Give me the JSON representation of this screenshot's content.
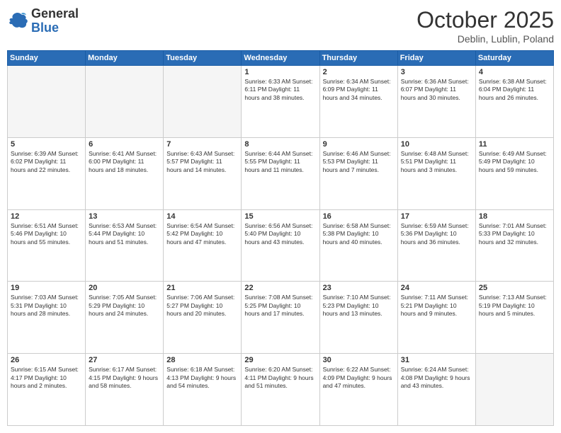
{
  "header": {
    "logo_general": "General",
    "logo_blue": "Blue",
    "month": "October 2025",
    "location": "Deblin, Lublin, Poland"
  },
  "weekdays": [
    "Sunday",
    "Monday",
    "Tuesday",
    "Wednesday",
    "Thursday",
    "Friday",
    "Saturday"
  ],
  "weeks": [
    [
      {
        "day": "",
        "info": ""
      },
      {
        "day": "",
        "info": ""
      },
      {
        "day": "",
        "info": ""
      },
      {
        "day": "1",
        "info": "Sunrise: 6:33 AM\nSunset: 6:11 PM\nDaylight: 11 hours\nand 38 minutes."
      },
      {
        "day": "2",
        "info": "Sunrise: 6:34 AM\nSunset: 6:09 PM\nDaylight: 11 hours\nand 34 minutes."
      },
      {
        "day": "3",
        "info": "Sunrise: 6:36 AM\nSunset: 6:07 PM\nDaylight: 11 hours\nand 30 minutes."
      },
      {
        "day": "4",
        "info": "Sunrise: 6:38 AM\nSunset: 6:04 PM\nDaylight: 11 hours\nand 26 minutes."
      }
    ],
    [
      {
        "day": "5",
        "info": "Sunrise: 6:39 AM\nSunset: 6:02 PM\nDaylight: 11 hours\nand 22 minutes."
      },
      {
        "day": "6",
        "info": "Sunrise: 6:41 AM\nSunset: 6:00 PM\nDaylight: 11 hours\nand 18 minutes."
      },
      {
        "day": "7",
        "info": "Sunrise: 6:43 AM\nSunset: 5:57 PM\nDaylight: 11 hours\nand 14 minutes."
      },
      {
        "day": "8",
        "info": "Sunrise: 6:44 AM\nSunset: 5:55 PM\nDaylight: 11 hours\nand 11 minutes."
      },
      {
        "day": "9",
        "info": "Sunrise: 6:46 AM\nSunset: 5:53 PM\nDaylight: 11 hours\nand 7 minutes."
      },
      {
        "day": "10",
        "info": "Sunrise: 6:48 AM\nSunset: 5:51 PM\nDaylight: 11 hours\nand 3 minutes."
      },
      {
        "day": "11",
        "info": "Sunrise: 6:49 AM\nSunset: 5:49 PM\nDaylight: 10 hours\nand 59 minutes."
      }
    ],
    [
      {
        "day": "12",
        "info": "Sunrise: 6:51 AM\nSunset: 5:46 PM\nDaylight: 10 hours\nand 55 minutes."
      },
      {
        "day": "13",
        "info": "Sunrise: 6:53 AM\nSunset: 5:44 PM\nDaylight: 10 hours\nand 51 minutes."
      },
      {
        "day": "14",
        "info": "Sunrise: 6:54 AM\nSunset: 5:42 PM\nDaylight: 10 hours\nand 47 minutes."
      },
      {
        "day": "15",
        "info": "Sunrise: 6:56 AM\nSunset: 5:40 PM\nDaylight: 10 hours\nand 43 minutes."
      },
      {
        "day": "16",
        "info": "Sunrise: 6:58 AM\nSunset: 5:38 PM\nDaylight: 10 hours\nand 40 minutes."
      },
      {
        "day": "17",
        "info": "Sunrise: 6:59 AM\nSunset: 5:36 PM\nDaylight: 10 hours\nand 36 minutes."
      },
      {
        "day": "18",
        "info": "Sunrise: 7:01 AM\nSunset: 5:33 PM\nDaylight: 10 hours\nand 32 minutes."
      }
    ],
    [
      {
        "day": "19",
        "info": "Sunrise: 7:03 AM\nSunset: 5:31 PM\nDaylight: 10 hours\nand 28 minutes."
      },
      {
        "day": "20",
        "info": "Sunrise: 7:05 AM\nSunset: 5:29 PM\nDaylight: 10 hours\nand 24 minutes."
      },
      {
        "day": "21",
        "info": "Sunrise: 7:06 AM\nSunset: 5:27 PM\nDaylight: 10 hours\nand 20 minutes."
      },
      {
        "day": "22",
        "info": "Sunrise: 7:08 AM\nSunset: 5:25 PM\nDaylight: 10 hours\nand 17 minutes."
      },
      {
        "day": "23",
        "info": "Sunrise: 7:10 AM\nSunset: 5:23 PM\nDaylight: 10 hours\nand 13 minutes."
      },
      {
        "day": "24",
        "info": "Sunrise: 7:11 AM\nSunset: 5:21 PM\nDaylight: 10 hours\nand 9 minutes."
      },
      {
        "day": "25",
        "info": "Sunrise: 7:13 AM\nSunset: 5:19 PM\nDaylight: 10 hours\nand 5 minutes."
      }
    ],
    [
      {
        "day": "26",
        "info": "Sunrise: 6:15 AM\nSunset: 4:17 PM\nDaylight: 10 hours\nand 2 minutes."
      },
      {
        "day": "27",
        "info": "Sunrise: 6:17 AM\nSunset: 4:15 PM\nDaylight: 9 hours\nand 58 minutes."
      },
      {
        "day": "28",
        "info": "Sunrise: 6:18 AM\nSunset: 4:13 PM\nDaylight: 9 hours\nand 54 minutes."
      },
      {
        "day": "29",
        "info": "Sunrise: 6:20 AM\nSunset: 4:11 PM\nDaylight: 9 hours\nand 51 minutes."
      },
      {
        "day": "30",
        "info": "Sunrise: 6:22 AM\nSunset: 4:09 PM\nDaylight: 9 hours\nand 47 minutes."
      },
      {
        "day": "31",
        "info": "Sunrise: 6:24 AM\nSunset: 4:08 PM\nDaylight: 9 hours\nand 43 minutes."
      },
      {
        "day": "",
        "info": ""
      }
    ]
  ]
}
